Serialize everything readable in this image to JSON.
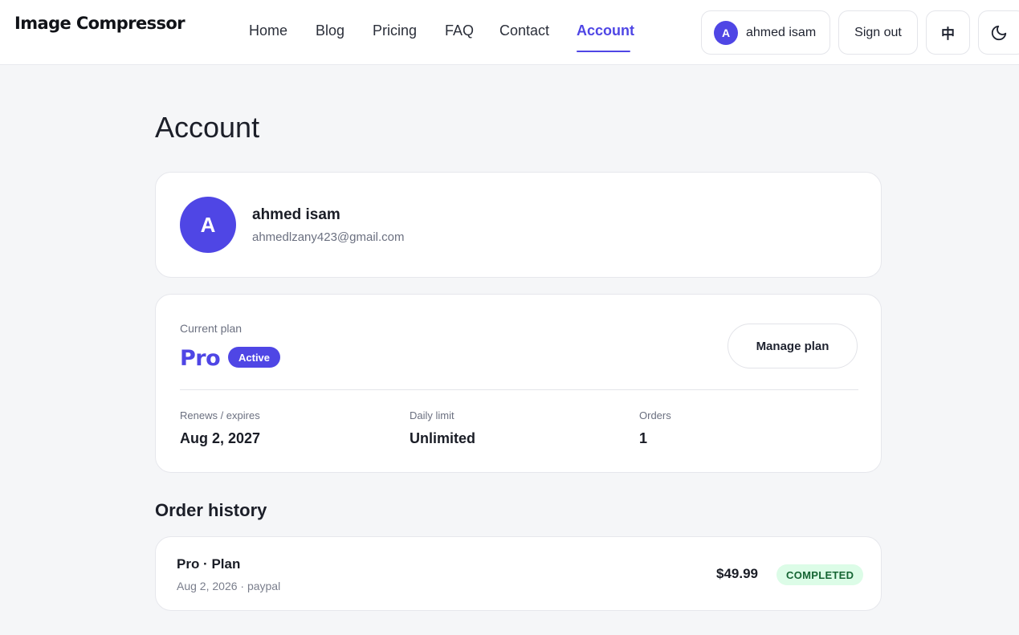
{
  "header": {
    "brand": "Image Compressor",
    "nav": [
      {
        "label": "Home"
      },
      {
        "label": "Blog"
      },
      {
        "label": "Pricing"
      },
      {
        "label": "FAQ"
      },
      {
        "label": "Contact"
      },
      {
        "label": "Account",
        "active": true
      }
    ],
    "user": {
      "initial": "A",
      "name": "ahmed isam"
    },
    "sign_out_label": "Sign out",
    "language_label": "中",
    "theme_icon": "moon-icon"
  },
  "page": {
    "title": "Account"
  },
  "profile": {
    "initial": "A",
    "name": "ahmed isam",
    "email": "ahmedlzany423@gmail.com"
  },
  "plan": {
    "label": "Current plan",
    "name": "Pro",
    "status": "Active",
    "manage_label": "Manage plan",
    "stats": [
      {
        "label": "Renews / expires",
        "value": "Aug 2, 2027"
      },
      {
        "label": "Daily limit",
        "value": "Unlimited"
      },
      {
        "label": "Orders",
        "value": "1"
      }
    ]
  },
  "orders": {
    "title": "Order history",
    "items": [
      {
        "title": "Pro · Plan",
        "meta": "Aug 2, 2026 · paypal",
        "price": "$49.99",
        "status": "COMPLETED"
      }
    ]
  },
  "colors": {
    "accent": "#4f46e5",
    "success_bg": "#dcfce7",
    "success_text": "#166534",
    "page_bg": "#f5f6f8"
  }
}
